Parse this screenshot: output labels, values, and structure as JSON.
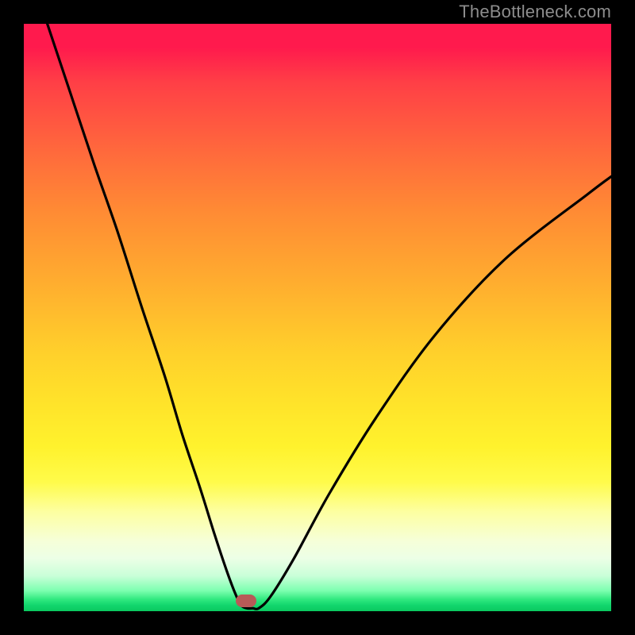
{
  "watermark": {
    "text": "TheBottleneck.com"
  },
  "marker": {
    "x_pct": 37.8,
    "y_pct": 98.3
  },
  "chart_data": {
    "type": "line",
    "title": "",
    "xlabel": "",
    "ylabel": "",
    "xlim": [
      0,
      100
    ],
    "ylim": [
      0,
      100
    ],
    "grid": false,
    "legend": false,
    "series": [
      {
        "name": "bottleneck-curve",
        "x": [
          4,
          8,
          12,
          16,
          20,
          24,
          27,
          30,
          32.5,
          34.5,
          36,
          37,
          38,
          39,
          40,
          42,
          46,
          52,
          60,
          70,
          82,
          96,
          100
        ],
        "y": [
          100,
          88,
          76,
          64.5,
          52,
          40,
          30,
          21,
          13,
          7,
          3,
          1,
          0.5,
          0.5,
          0.5,
          2.5,
          9,
          20,
          33,
          47,
          60,
          71,
          74
        ]
      }
    ],
    "annotations": [
      {
        "type": "marker",
        "shape": "rounded-rect",
        "color": "#b85a57",
        "x": 37.8,
        "y": 1.7
      }
    ],
    "background": {
      "type": "vertical-gradient",
      "stops": [
        {
          "pct": 0,
          "color": "#ff1a4d"
        },
        {
          "pct": 50,
          "color": "#ffc22c"
        },
        {
          "pct": 80,
          "color": "#fcff7a"
        },
        {
          "pct": 100,
          "color": "#0ac95f"
        }
      ]
    }
  }
}
